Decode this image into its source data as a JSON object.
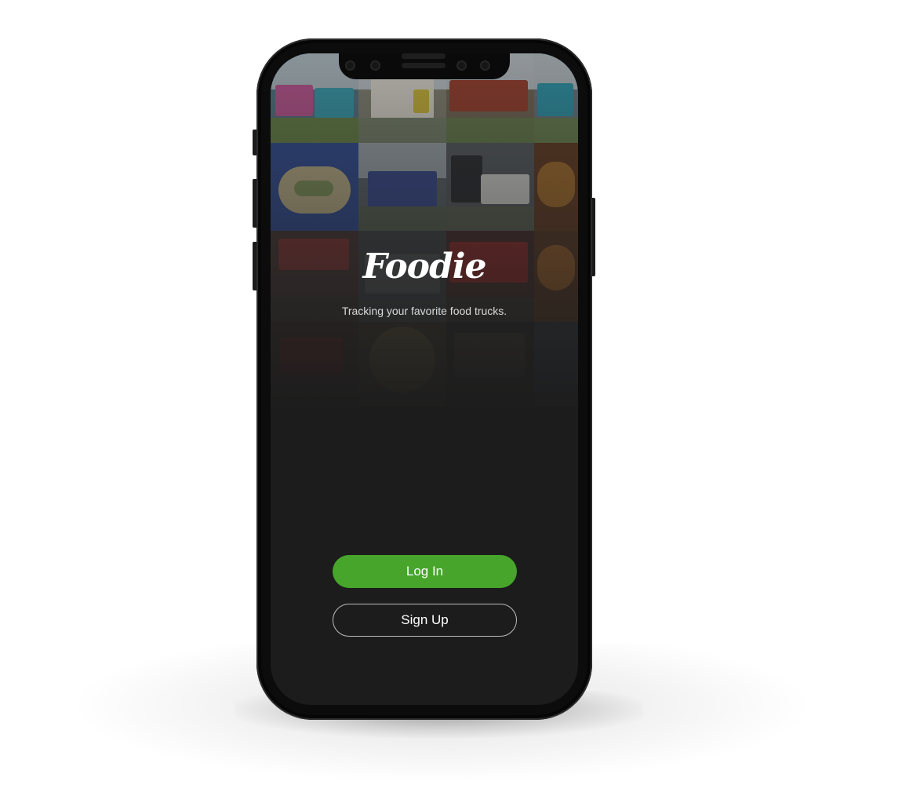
{
  "app": {
    "name": "Foodie",
    "tagline": "Tracking your favorite food trucks."
  },
  "actions": {
    "login_label": "Log In",
    "signup_label": "Sign Up"
  },
  "colors": {
    "login_button": "#46a52a",
    "screen_background": "#1c1c1c",
    "phone_frame": "#0c0c0c"
  }
}
